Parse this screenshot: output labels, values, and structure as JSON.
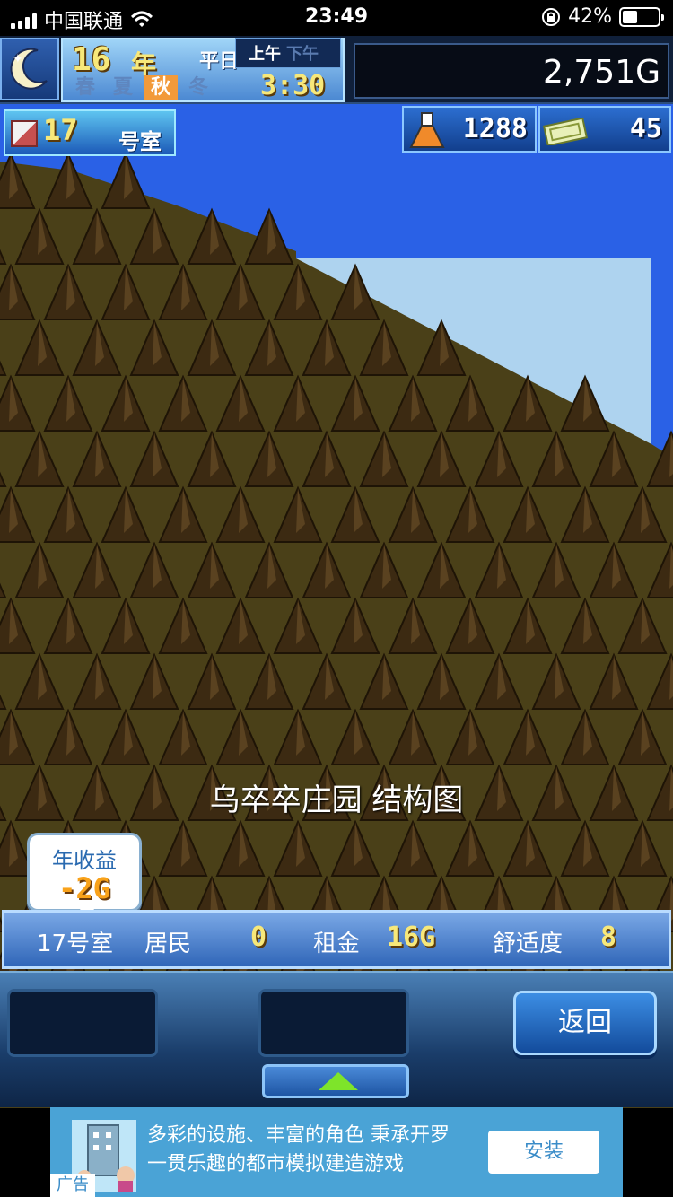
{
  "status_bar": {
    "carrier": "中国联通",
    "time": "23:49",
    "battery_text": "42%",
    "battery_level": 0.42,
    "icons": [
      "signal-icon",
      "wifi-icon",
      "rotation-lock-icon",
      "battery-icon"
    ]
  },
  "hud": {
    "year_number": "16",
    "year_unit": "年",
    "day_label": "平日",
    "seasons": [
      "春",
      "夏",
      "秋",
      "冬"
    ],
    "active_season": "秋",
    "am_label": "上午",
    "pm_label": "下午",
    "active_period": "上午",
    "clock": "3:30",
    "money": "2,751G",
    "moon_icon": "crescent-moon-icon"
  },
  "room_chip": {
    "number": "17",
    "unit": "号室",
    "icon": "room-box-icon"
  },
  "resources": {
    "research_points": "1288",
    "research_icon": "flask-icon",
    "tickets": "45",
    "tickets_icon": "ticket-icon"
  },
  "scene": {
    "structure_label": "乌卒卒庄园 结构图"
  },
  "income": {
    "title": "年收益",
    "value": "-2G"
  },
  "info_bar": {
    "room": "17号室",
    "residents_label": "居民",
    "residents": "0",
    "rent_label": "租金",
    "rent": "16G",
    "comfort_label": "舒适度",
    "comfort": "8"
  },
  "controls": {
    "back_label": "返回"
  },
  "ad": {
    "line1": "多彩的设施、丰富的角色 秉承开罗",
    "line2": "一贯乐趣的都市模拟建造游戏",
    "button": "安装",
    "tag": "广告"
  },
  "colors": {
    "sky_dark": "#2a61e6",
    "sky_light": "#aed3ef",
    "tree": "#3c2a12",
    "ground": "#4a4018",
    "accent_yellow": "#f7e87a",
    "ad_blue": "#4aa3d6"
  }
}
